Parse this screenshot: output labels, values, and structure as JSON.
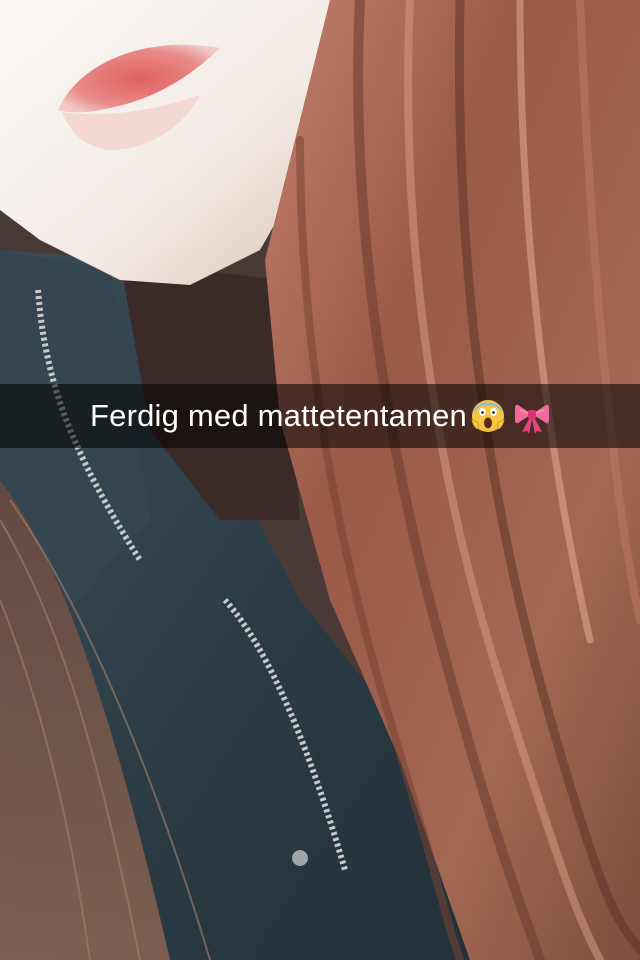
{
  "snap": {
    "caption": "Ferdig med mattetentamen",
    "emojis": [
      "face-screaming-in-fear-icon",
      "ribbon-icon"
    ]
  },
  "colors": {
    "caption_bar": "#000000",
    "caption_text": "#ffffff",
    "skin": "#f4ece7",
    "lips": "#e27a78",
    "hair": "#8a4e3c",
    "jacket": "#2f4049"
  }
}
